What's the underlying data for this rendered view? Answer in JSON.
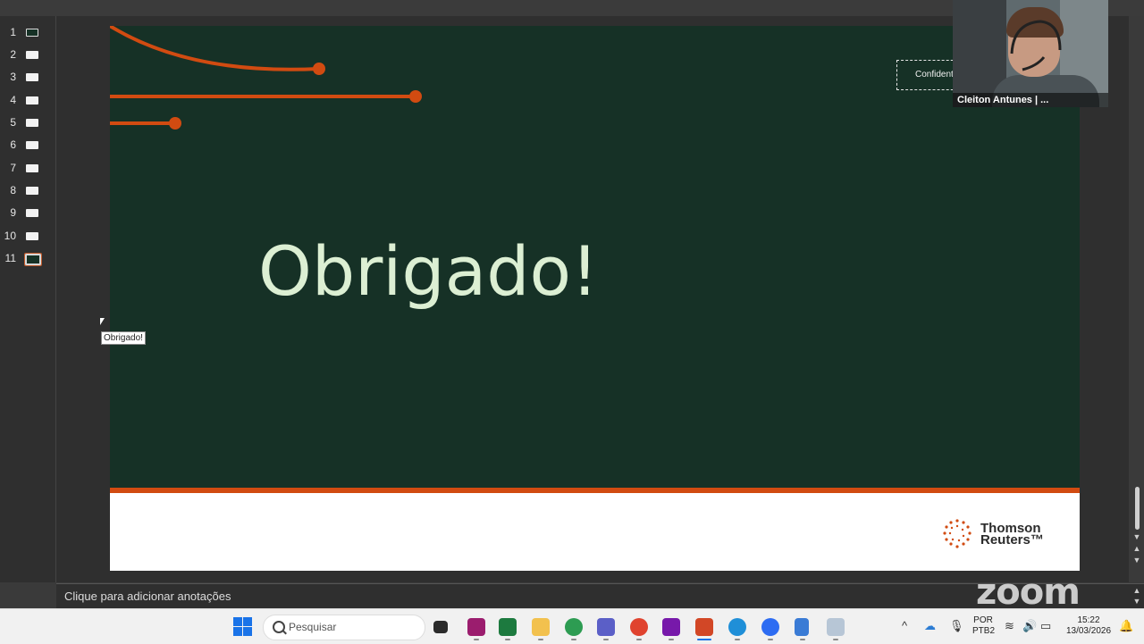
{
  "sidebar": {
    "slides": [
      {
        "number": "1",
        "style": "dark"
      },
      {
        "number": "2",
        "style": "light"
      },
      {
        "number": "3",
        "style": "light"
      },
      {
        "number": "4",
        "style": "light"
      },
      {
        "number": "5",
        "style": "light"
      },
      {
        "number": "6",
        "style": "light"
      },
      {
        "number": "7",
        "style": "light"
      },
      {
        "number": "8",
        "style": "light"
      },
      {
        "number": "9",
        "style": "light"
      },
      {
        "number": "10",
        "style": "light"
      },
      {
        "number": "11",
        "style": "dark-selected"
      }
    ]
  },
  "slide": {
    "title": "Obrigado!",
    "confidential_label": "Confident",
    "logo_line1": "Thomson",
    "logo_line2": "Reuters™",
    "colors": {
      "background": "#163126",
      "accent": "#d14b11",
      "title": "#dcefd3"
    }
  },
  "tooltip": {
    "text": "Obrigado!"
  },
  "notes": {
    "placeholder": "Clique para adicionar anotações"
  },
  "video": {
    "participant_name": "Cleiton Antunes | ..."
  },
  "watermark": {
    "text": "zoom"
  },
  "taskbar": {
    "search_placeholder": "Pesquisar",
    "language": "POR",
    "layout": "PTB2",
    "time": "15:22",
    "date": "13/03/2026"
  }
}
